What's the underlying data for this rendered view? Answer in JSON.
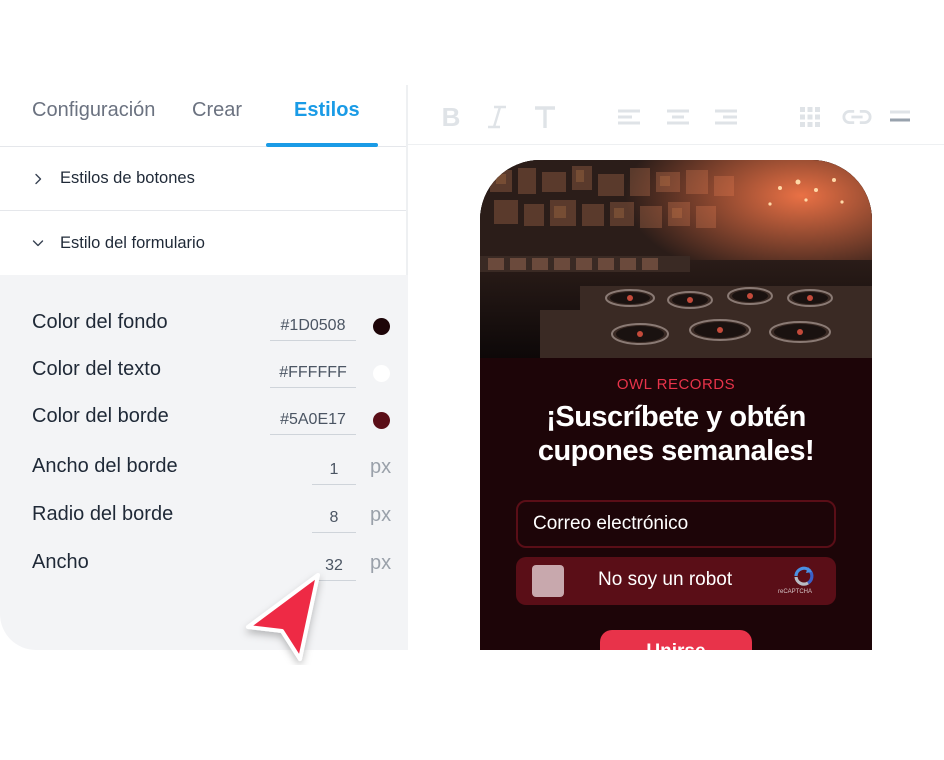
{
  "tabs": [
    {
      "label": "Configuración",
      "active": false
    },
    {
      "label": "Crear",
      "active": false
    },
    {
      "label": "Estilos",
      "active": true
    }
  ],
  "accordion": {
    "buttons_label": "Estilos de botones",
    "form_label": "Estilo del formulario"
  },
  "form_style": {
    "background_color": {
      "label": "Color del fondo",
      "value": "#1D0508"
    },
    "text_color": {
      "label": "Color del texto",
      "value": "#FFFFFF"
    },
    "border_color": {
      "label": "Color del borde",
      "value": "#5A0E17"
    },
    "border_width": {
      "label": "Ancho del borde",
      "value": "1",
      "unit": "px"
    },
    "border_radius": {
      "label": "Radio del borde",
      "value": "8",
      "unit": "px"
    },
    "width": {
      "label": "Ancho",
      "value": "32",
      "unit": "px"
    }
  },
  "toolbar": {
    "icons": [
      "bold-icon",
      "italic-icon",
      "text-size-icon",
      "align-left-icon",
      "align-center-icon",
      "align-right-icon",
      "grid-icon",
      "link-icon",
      "divider-icon"
    ]
  },
  "preview": {
    "brand": "OWL RECORDS",
    "headline_line1": "¡Suscríbete y obtén",
    "headline_line2": "cupones semanales!",
    "email_placeholder": "Correo electrónico",
    "captcha_text": "No soy un robot",
    "captcha_brand": "reCAPTCHA",
    "submit_label": "Unirse"
  },
  "colors": {
    "accent": "#1A9BE6",
    "preview_bg": "#1D0508",
    "preview_border": "#5A0E17",
    "brand_red": "#E8334A"
  }
}
